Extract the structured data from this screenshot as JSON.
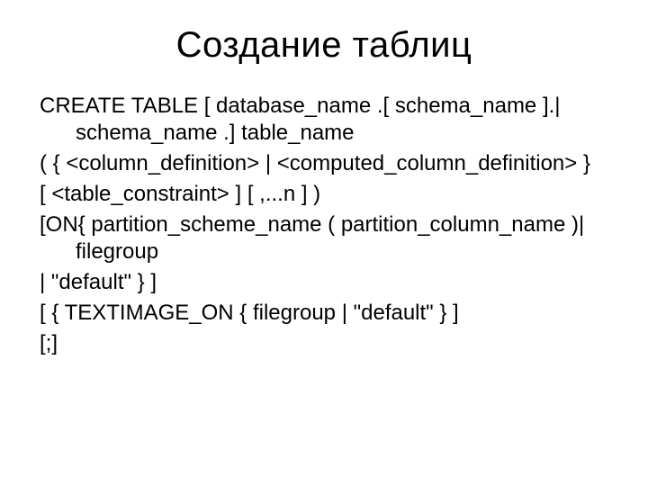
{
  "title": "Создание таблиц",
  "lines": [
    "CREATE TABLE  [ database_name .[ schema_name ].| schema_name .] table_name",
    "( { <column_definition> | <computed_column_definition> }",
    "[ <table_constraint> ] [ ,...n ] )",
    "[ON{ partition_scheme_name ( partition_column_name )| filegroup",
    "| \"default\" } ]",
    "[ { TEXTIMAGE_ON { filegroup | \"default\" } ]",
    "[;]"
  ]
}
